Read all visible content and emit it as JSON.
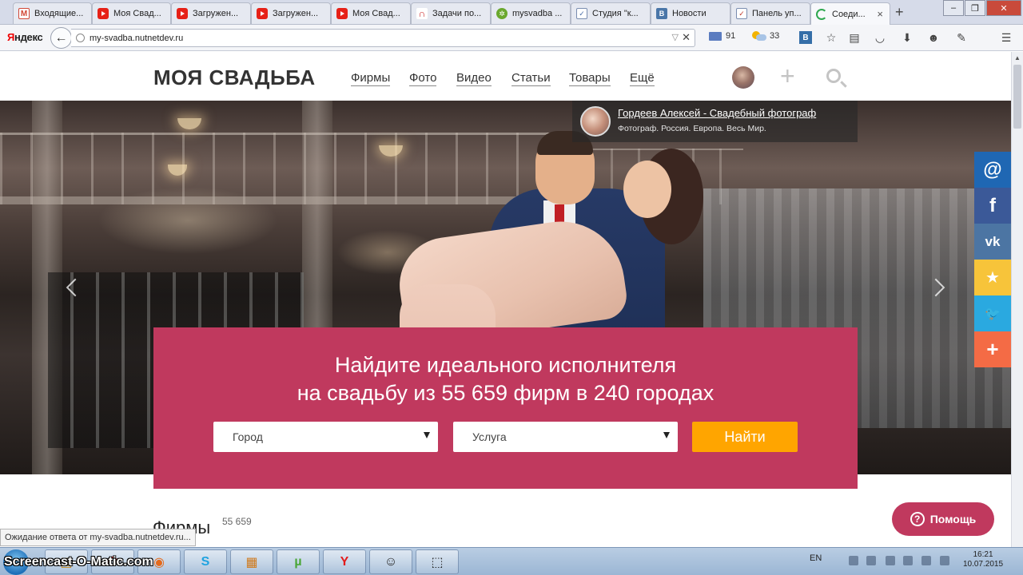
{
  "browser": {
    "tabs": [
      {
        "label": "Входящие...",
        "favicon": "gmail-icon",
        "favicon_text": "M"
      },
      {
        "label": "Моя Свад...",
        "favicon": "youtube-icon",
        "favicon_text": ""
      },
      {
        "label": "Загружен...",
        "favicon": "youtube-icon",
        "favicon_text": ""
      },
      {
        "label": "Загружен...",
        "favicon": "youtube-icon",
        "favicon_text": ""
      },
      {
        "label": "Моя Свад...",
        "favicon": "youtube-icon",
        "favicon_text": ""
      },
      {
        "label": "Задачи по...",
        "favicon": "tasks-icon",
        "favicon_text": "∩"
      },
      {
        "label": "mysvadba ...",
        "favicon": "gear-icon",
        "favicon_text": "✲"
      },
      {
        "label": "Студия \"к...",
        "favicon": "studio-icon",
        "favicon_text": "✓"
      },
      {
        "label": "Новости",
        "favicon": "vk-icon",
        "favicon_text": "B"
      },
      {
        "label": "Панель уп...",
        "favicon": "panel-icon",
        "favicon_text": "✓"
      },
      {
        "label": "Соеди...",
        "favicon": "loading-icon",
        "favicon_text": "",
        "active": true
      }
    ],
    "yandex": {
      "first_letter": "Я",
      "rest": "ндекс"
    },
    "url": {
      "host": "my-svadba.nutnetdev.ru"
    },
    "mail_count": "91",
    "weather_temp": "33",
    "status_tip": "Ожидание ответа от my-svadba.nutnetdev.ru...",
    "window_controls": {
      "minimize": "–",
      "restore": "❐",
      "close": "✕"
    }
  },
  "site": {
    "logo": "МОЯ СВАДЬБА",
    "menu": [
      "Фирмы",
      "Фото",
      "Видео",
      "Статьи",
      "Товары",
      "Ещё"
    ],
    "photo_credit": {
      "name": "Гордеев Алексей - Свадебный фотограф",
      "description": "Фотограф. Россия. Европа. Весь Мир."
    },
    "search": {
      "title_line1": "Найдите идеального исполнителя",
      "title_line2": "на свадьбу из 55 659 фирм в 240 городах",
      "city_label": "Город",
      "service_label": "Услуга",
      "find_label": "Найти"
    },
    "section": {
      "title": "Фирмы",
      "count": "55 659"
    },
    "help_label": "Помощь",
    "social": [
      {
        "name": "mail-ru",
        "glyph": "@",
        "color": "#1f67b3"
      },
      {
        "name": "facebook",
        "glyph": "f",
        "color": "#3b5998"
      },
      {
        "name": "vk",
        "glyph": "vk",
        "color": "#4c75a3"
      },
      {
        "name": "favorites",
        "glyph": "★",
        "color": "#f7c43a"
      },
      {
        "name": "twitter",
        "glyph": "🐦",
        "color": "#2aa9e0"
      },
      {
        "name": "more",
        "glyph": "+",
        "color": "#f46b45"
      }
    ]
  },
  "taskbar": {
    "watermark": "Screencast-O-Matic.com",
    "language": "EN",
    "time": "16:21",
    "date": "10.07.2015",
    "apps": [
      {
        "name": "folder-icon",
        "glyph": "▤"
      },
      {
        "name": "opera-icon",
        "glyph": "O"
      },
      {
        "name": "firefox-icon",
        "glyph": "◉"
      },
      {
        "name": "skype-icon",
        "glyph": "S"
      },
      {
        "name": "paint-icon",
        "glyph": "▦"
      },
      {
        "name": "utorrent-icon",
        "glyph": "µ"
      },
      {
        "name": "yandex-browser-icon",
        "glyph": "Y"
      },
      {
        "name": "smiley-icon",
        "glyph": "☺"
      },
      {
        "name": "screen-capture-icon",
        "glyph": "⬚"
      }
    ]
  }
}
